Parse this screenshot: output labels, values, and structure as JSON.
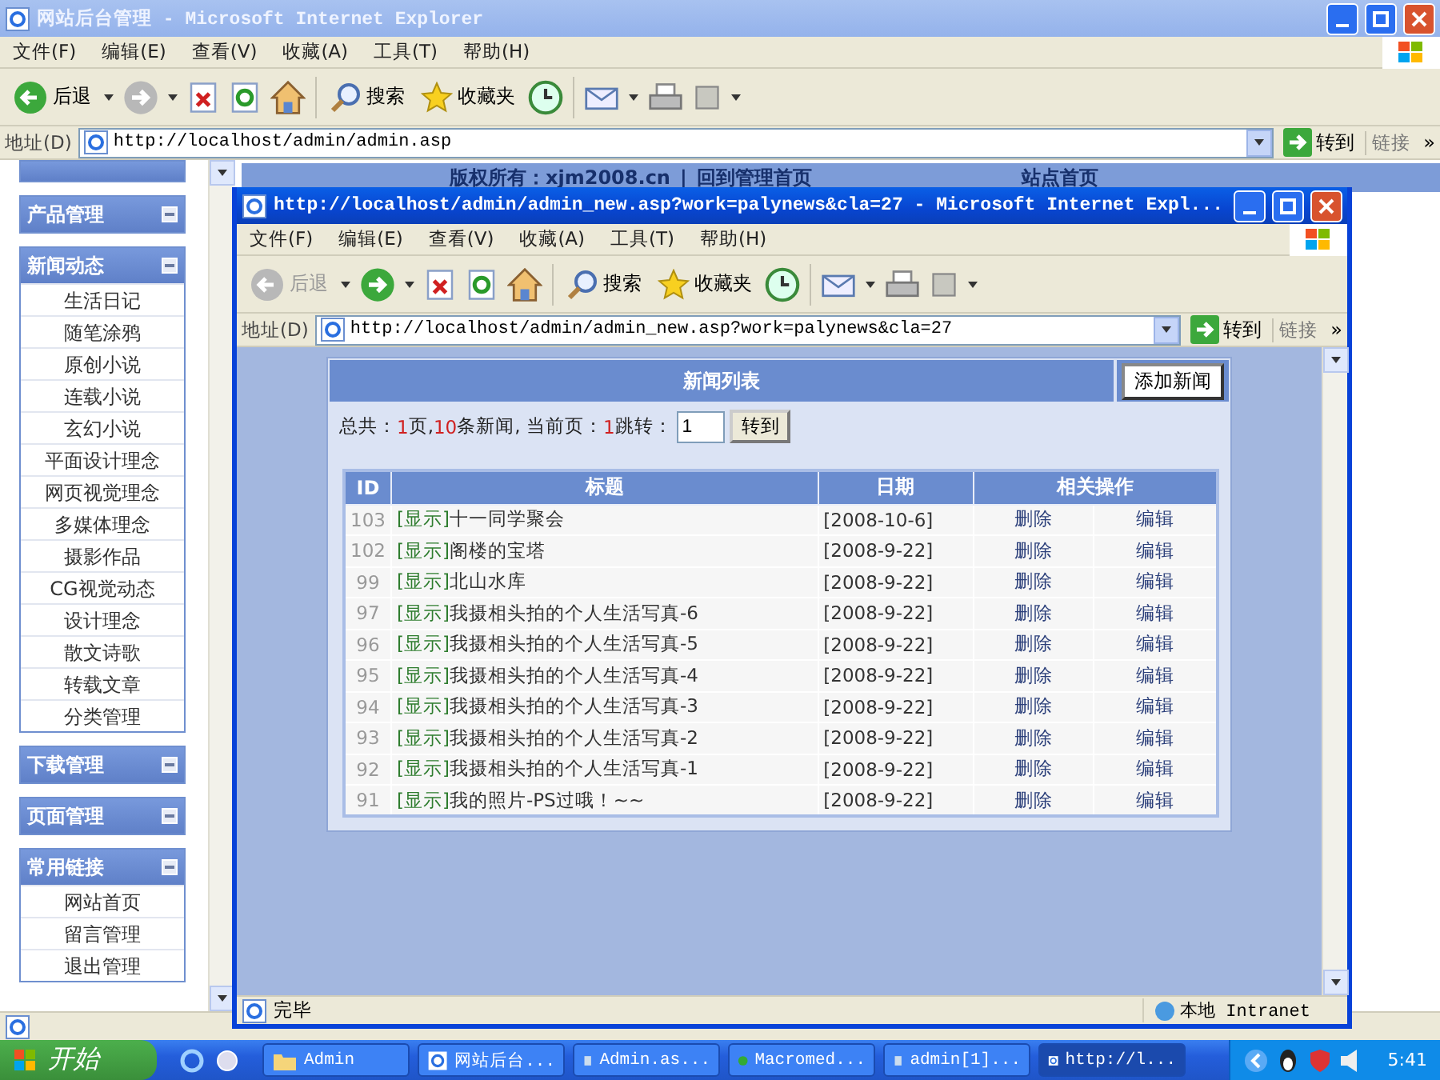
{
  "outer": {
    "title": "网站后台管理 - Microsoft Internet Explorer",
    "active": false,
    "menu": [
      "文件(F)",
      "编辑(E)",
      "查看(V)",
      "收藏(A)",
      "工具(T)",
      "帮助(H)"
    ],
    "toolbar": {
      "back": "后退",
      "back_enabled": true,
      "search": "搜索",
      "favorites": "收藏夹"
    },
    "address": {
      "label": "地址(D)",
      "value": "http://localhost/admin/admin.asp",
      "go": "转到",
      "links": "链接",
      "more": "»"
    }
  },
  "sidebar": {
    "groups": [
      {
        "title": "产品管理"
      },
      {
        "title": "新闻动态",
        "items": [
          "生活日记",
          "随笔涂鸦",
          "原创小说",
          "连载小说",
          "玄幻小说",
          "平面设计理念",
          "网页视觉理念",
          "多媒体理念",
          "摄影作品",
          "CG视觉动态",
          "设计理念",
          "散文诗歌",
          "转载文章",
          "分类管理"
        ]
      },
      {
        "title": "下载管理"
      },
      {
        "title": "页面管理"
      },
      {
        "title": "常用链接",
        "items": [
          "网站首页",
          "留言管理",
          "退出管理"
        ]
      }
    ]
  },
  "header_strip": {
    "copyright": "版权所有：xjm2008.cn",
    "separator": "|",
    "home_link": "回到管理首页",
    "site_link": "站点首页"
  },
  "inner": {
    "title": "http://localhost/admin/admin_new.asp?work=palynews&cla=27 - Microsoft Internet Expl...",
    "active": true,
    "menu": [
      "文件(F)",
      "编辑(E)",
      "查看(V)",
      "收藏(A)",
      "工具(T)",
      "帮助(H)"
    ],
    "toolbar": {
      "back": "后退",
      "back_enabled": false,
      "search": "搜索",
      "favorites": "收藏夹"
    },
    "address": {
      "label": "地址(D)",
      "value": "http://localhost/admin/admin_new.asp?work=palynews&cla=27",
      "go": "转到",
      "links": "链接",
      "more": "»"
    },
    "status": {
      "text": "完毕",
      "zone": "本地 Intranet"
    }
  },
  "news_panel": {
    "title": "新闻列表",
    "add_button": "添加新闻",
    "summary": [
      {
        "kind": "label",
        "text": "总共："
      },
      {
        "kind": "count",
        "text": "1"
      },
      {
        "kind": "label",
        "text": "页,"
      },
      {
        "kind": "count",
        "text": "10"
      },
      {
        "kind": "label",
        "text": "条新闻, 当前页："
      },
      {
        "kind": "count",
        "text": "1"
      },
      {
        "kind": "label",
        "text": "跳转："
      }
    ],
    "jump_value": "1",
    "jump_button": "转到",
    "columns": [
      "ID",
      "标题",
      "日期",
      "相关操作"
    ],
    "rows": [
      {
        "id": "103",
        "tag": "[显示]",
        "title": "十一同学聚会",
        "date": "[2008-10-6]",
        "actions": [
          "删除",
          "编辑"
        ]
      },
      {
        "id": "102",
        "tag": "[显示]",
        "title": "阁楼的宝塔",
        "date": "[2008-9-22]",
        "actions": [
          "删除",
          "编辑"
        ]
      },
      {
        "id": "99",
        "tag": "[显示]",
        "title": "北山水库",
        "date": "[2008-9-22]",
        "actions": [
          "删除",
          "编辑"
        ]
      },
      {
        "id": "97",
        "tag": "[显示]",
        "title": "我摄相头拍的个人生活写真-6",
        "date": "[2008-9-22]",
        "actions": [
          "删除",
          "编辑"
        ]
      },
      {
        "id": "96",
        "tag": "[显示]",
        "title": "我摄相头拍的个人生活写真-5",
        "date": "[2008-9-22]",
        "actions": [
          "删除",
          "编辑"
        ]
      },
      {
        "id": "95",
        "tag": "[显示]",
        "title": "我摄相头拍的个人生活写真-4",
        "date": "[2008-9-22]",
        "actions": [
          "删除",
          "编辑"
        ]
      },
      {
        "id": "94",
        "tag": "[显示]",
        "title": "我摄相头拍的个人生活写真-3",
        "date": "[2008-9-22]",
        "actions": [
          "删除",
          "编辑"
        ]
      },
      {
        "id": "93",
        "tag": "[显示]",
        "title": "我摄相头拍的个人生活写真-2",
        "date": "[2008-9-22]",
        "actions": [
          "删除",
          "编辑"
        ]
      },
      {
        "id": "92",
        "tag": "[显示]",
        "title": "我摄相头拍的个人生活写真-1",
        "date": "[2008-9-22]",
        "actions": [
          "删除",
          "编辑"
        ]
      },
      {
        "id": "91",
        "tag": "[显示]",
        "title": "我的照片-PS过哦！~~",
        "date": "[2008-9-22]",
        "actions": [
          "删除",
          "编辑"
        ]
      }
    ]
  },
  "taskbar": {
    "start": "开始",
    "tasks": [
      {
        "label": "Admin",
        "kind": "folder",
        "selected": false
      },
      {
        "label": "网站后台...",
        "kind": "browser",
        "selected": false
      },
      {
        "label": "Admin.as...",
        "kind": "file",
        "selected": false
      },
      {
        "label": "Macromed...",
        "kind": "app",
        "selected": false
      },
      {
        "label": "admin[1]...",
        "kind": "file",
        "selected": false
      },
      {
        "label": "http://l...",
        "kind": "browser",
        "selected": true
      }
    ],
    "clock": "5:41"
  }
}
